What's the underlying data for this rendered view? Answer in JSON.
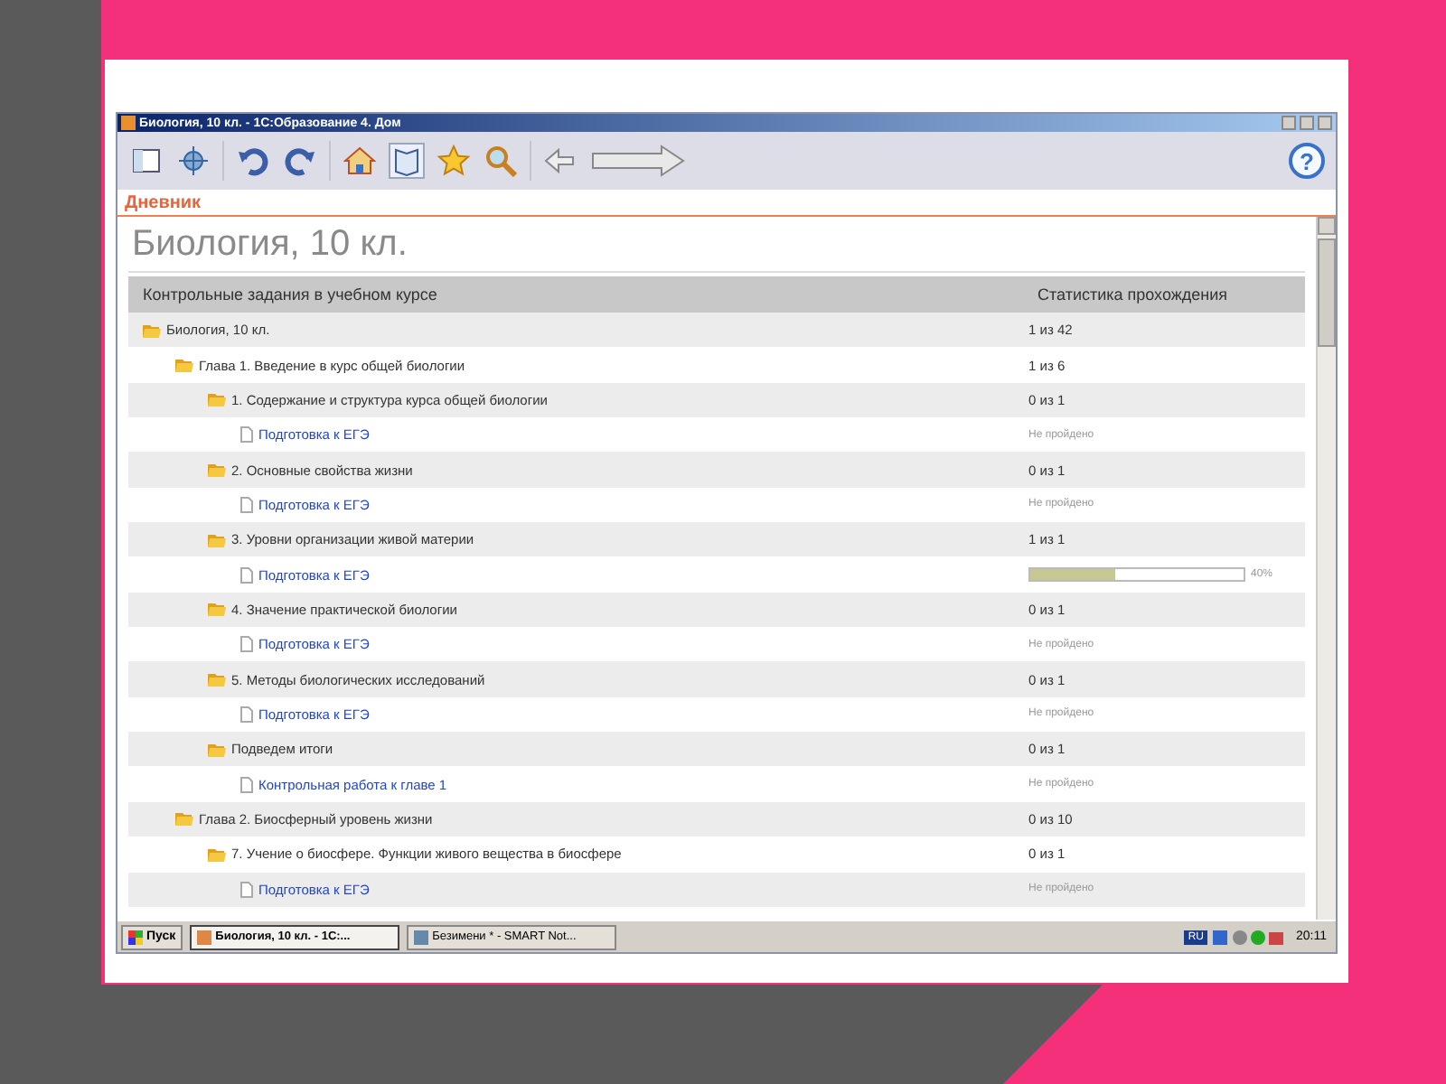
{
  "window": {
    "title": "Биология, 10 кл. - 1С:Образование 4. Дом"
  },
  "toolbar": {
    "help_label": "?"
  },
  "tab": {
    "label": "Дневник"
  },
  "page_title": "Биология, 10 кл.",
  "table": {
    "columns": [
      "Контрольные задания в учебном курсе",
      "Статистика прохождения"
    ],
    "rows": [
      {
        "kind": "folder",
        "title": "Биология, 10 кл.",
        "stat": "1 из 42",
        "children": [
          {
            "kind": "folder",
            "title": "Глава 1. Введение в курс общей биологии",
            "stat": "1 из 6",
            "children": [
              {
                "kind": "folder",
                "title": "1. Содержание и структура курса общей биологии",
                "stat": "0 из 1",
                "children": [
                  {
                    "kind": "doc",
                    "title": "Подготовка к ЕГЭ",
                    "stat": "Не пройдено"
                  }
                ]
              },
              {
                "kind": "folder",
                "title": "2. Основные свойства жизни",
                "stat": "0 из 1",
                "children": [
                  {
                    "kind": "doc",
                    "title": "Подготовка к ЕГЭ",
                    "stat": "Не пройдено"
                  }
                ]
              },
              {
                "kind": "folder",
                "title": "3. Уровни организации живой материи",
                "stat": "1 из 1",
                "children": [
                  {
                    "kind": "doc",
                    "title": "Подготовка к ЕГЭ",
                    "level": 0.4,
                    "reading": "40%"
                  }
                ]
              },
              {
                "kind": "folder",
                "title": "4. Значение практической биологии",
                "stat": "0 из 1",
                "children": [
                  {
                    "kind": "doc",
                    "title": "Подготовка к ЕГЭ",
                    "stat": "Не пройдено"
                  }
                ]
              },
              {
                "kind": "folder",
                "title": "5. Методы биологических исследований",
                "stat": "0 из 1",
                "children": [
                  {
                    "kind": "doc",
                    "title": "Подготовка к ЕГЭ",
                    "stat": "Не пройдено"
                  }
                ]
              },
              {
                "kind": "folder",
                "title": "Подведем итоги",
                "stat": "0 из 1",
                "children": [
                  {
                    "kind": "doc",
                    "title": "Контрольная работа к главе 1",
                    "stat": "Не пройдено"
                  }
                ]
              }
            ]
          },
          {
            "kind": "folder",
            "title": "Глава 2. Биосферный уровень жизни",
            "stat": "0 из 10",
            "children": [
              {
                "kind": "folder",
                "title": "7. Учение о биосфере. Функции живого вещества в биосфере",
                "stat": "0 из 1",
                "children": [
                  {
                    "kind": "doc",
                    "title": "Подготовка к ЕГЭ",
                    "stat": "Не пройдено"
                  }
                ]
              }
            ]
          }
        ]
      }
    ]
  },
  "taskbar": {
    "start": "Пуск",
    "tasks": [
      {
        "label": "Биология, 10 кл. - 1С:...",
        "selected": true
      },
      {
        "label": "Безимени * - SMART Not...",
        "selected": false
      }
    ],
    "language": "RU",
    "clock": "20:11"
  }
}
